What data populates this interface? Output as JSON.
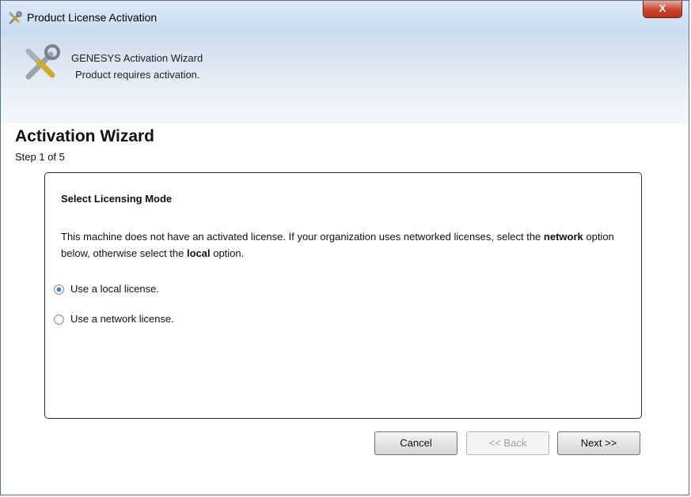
{
  "window": {
    "title": "Product License Activation",
    "close_label": "X"
  },
  "header": {
    "title": "GENESYS Activation Wizard",
    "subtitle": "Product requires activation."
  },
  "wizard": {
    "title": "Activation Wizard",
    "step": "Step 1 of 5"
  },
  "panel": {
    "heading": "Select Licensing Mode",
    "desc_part1": "This machine does not have an activated license. If your organization uses networked licenses, select the ",
    "desc_bold1": "network",
    "desc_part2": " option below, otherwise select the ",
    "desc_bold2": "local",
    "desc_part3": " option.",
    "options": [
      {
        "label": "Use a local license.",
        "checked": true
      },
      {
        "label": "Use a network license.",
        "checked": false
      }
    ]
  },
  "buttons": {
    "cancel": "Cancel",
    "back": "<< Back",
    "next": "Next >>"
  }
}
